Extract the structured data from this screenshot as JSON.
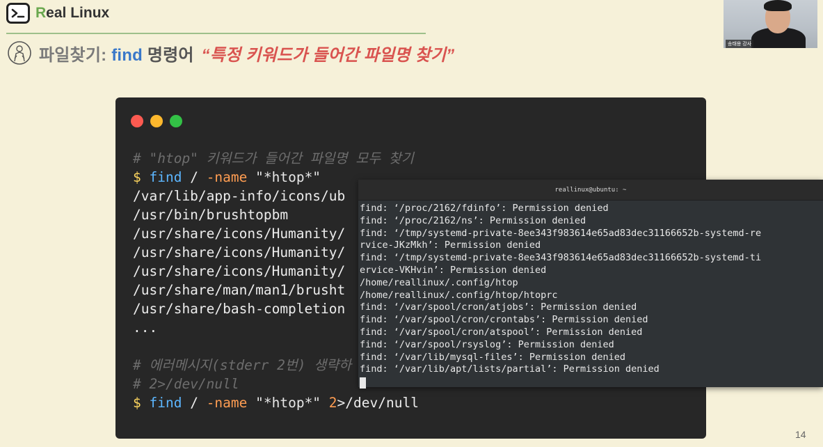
{
  "header": {
    "logo_r": "R",
    "logo_rest": "eal Linux",
    "icon": "terminal-prompt-icon"
  },
  "title": {
    "prefix": "파일찾기: ",
    "command": "find",
    "cmd_suffix": " 명령어 ",
    "quote": "“특정 키워드가 들어간 파일명 찾기”"
  },
  "webcam": {
    "name_tag": "송태용 강사"
  },
  "code_window": {
    "comment1": "# \"htop\" 키워드가 들어간 파일명 모두 찾기",
    "cmd1": {
      "prompt": "$ ",
      "cmd": "find",
      "path": " / ",
      "opt": "-name",
      "arg": " \"*htop*\""
    },
    "outputs": [
      "/var/lib/app-info/icons/ub",
      "/usr/bin/brushtopbm",
      "/usr/share/icons/Humanity/",
      "/usr/share/icons/Humanity/",
      "/usr/share/icons/Humanity/",
      "/usr/share/man/man1/brusht",
      "/usr/share/bash-completion"
    ],
    "ellipsis": "...",
    "comment2": "# 에러메시지(stderr 2번) 생략하",
    "comment3": "# 2>/dev/null",
    "cmd2": {
      "prompt": "$ ",
      "cmd": "find",
      "path": " / ",
      "opt": "-name",
      "arg": " \"*htop*\" ",
      "fd": "2",
      "redir": ">/dev/null"
    }
  },
  "terminal": {
    "title": "reallinux@ubuntu: ~",
    "lines": [
      "find: ‘/proc/2162/fdinfo’: Permission denied",
      "find: ‘/proc/2162/ns’: Permission denied",
      "find: ‘/tmp/systemd-private-8ee343f983614e65ad83dec31166652b-systemd-re",
      "rvice-JKzMkh’: Permission denied",
      "find: ‘/tmp/systemd-private-8ee343f983614e65ad83dec31166652b-systemd-ti",
      "ervice-VKHvin’: Permission denied",
      "/home/reallinux/.config/htop",
      "/home/reallinux/.config/htop/htoprc",
      "find: ‘/var/spool/cron/atjobs’: Permission denied",
      "find: ‘/var/spool/cron/crontabs’: Permission denied",
      "find: ‘/var/spool/cron/atspool’: Permission denied",
      "find: ‘/var/spool/rsyslog’: Permission denied",
      "find: ‘/var/lib/mysql-files’: Permission denied",
      "find: ‘/var/lib/apt/lists/partial’: Permission denied"
    ]
  },
  "page_number": "14",
  "colors": {
    "background": "#f6f1d9",
    "accent_green": "#6aa84f",
    "command_blue": "#3a78c9",
    "quote_red": "#d9534f",
    "code_bg": "#272727",
    "terminal_bg": "#2f3336"
  }
}
